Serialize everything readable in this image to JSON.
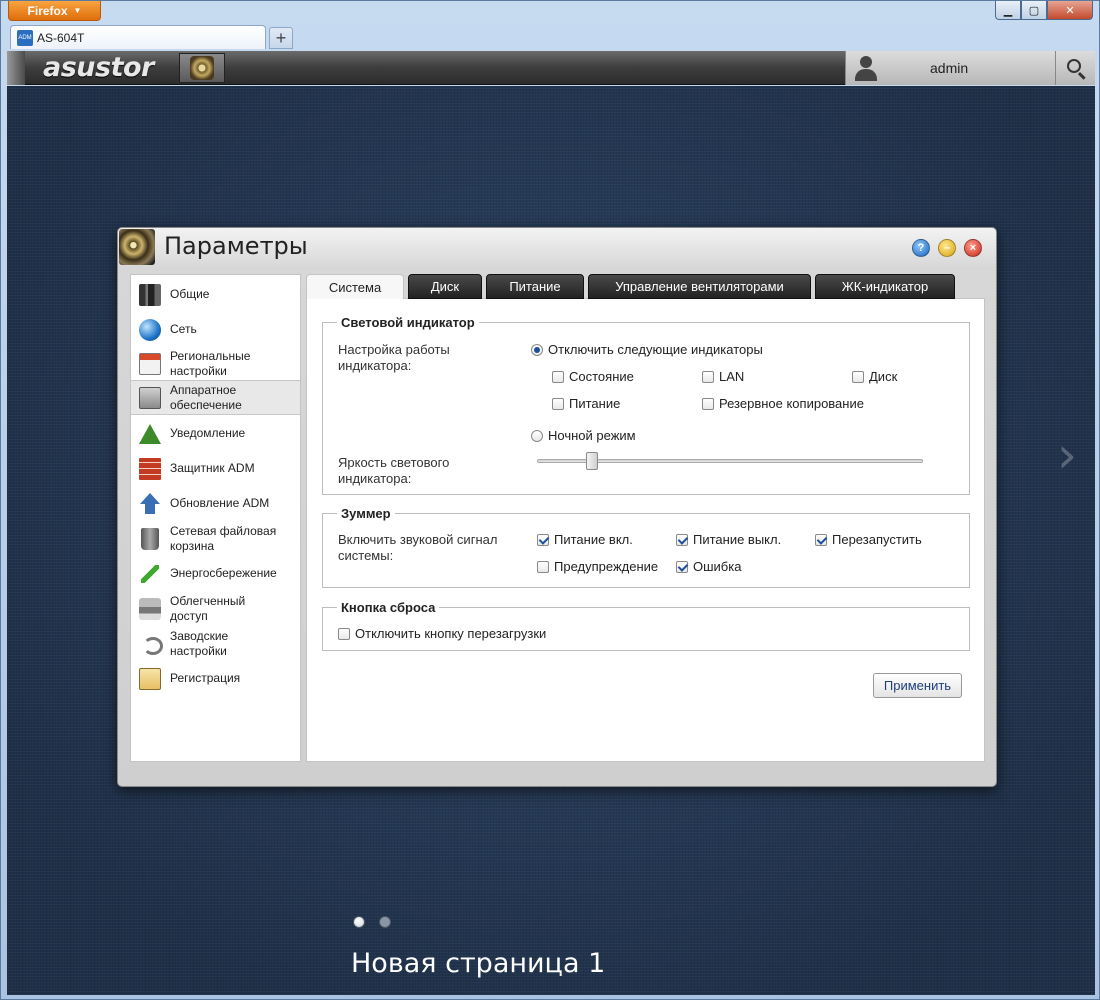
{
  "browser": {
    "app_button": "Firefox",
    "tab_title": "AS-604T",
    "tab_favicon": "ADM",
    "new_tab": "+",
    "controls": {
      "minimize": "▁",
      "maximize": "▢",
      "close": "✕"
    }
  },
  "adm": {
    "logo": "asustor",
    "user": "admin"
  },
  "settings": {
    "title": "Параметры",
    "buttons": {
      "help": "?",
      "minimize": "–",
      "close": "×"
    },
    "nav": [
      {
        "label": "Общие",
        "icon": "server-icon"
      },
      {
        "label": "Сеть",
        "icon": "globe-icon"
      },
      {
        "label": "Региональные настройки",
        "icon": "calendar-clock-icon"
      },
      {
        "label": "Аппаратное обеспечение",
        "icon": "hard-drive-icon"
      },
      {
        "label": "Уведомление",
        "icon": "warning-icon"
      },
      {
        "label": "Защитник ADM",
        "icon": "firewall-icon"
      },
      {
        "label": "Обновление ADM",
        "icon": "upload-arrow-icon"
      },
      {
        "label": "Сетевая файловая корзина",
        "icon": "trash-icon"
      },
      {
        "label": "Энергосбережение",
        "icon": "lightning-icon"
      },
      {
        "label": "Облегченный доступ",
        "icon": "printer-icon"
      },
      {
        "label": "Заводские настройки",
        "icon": "undo-icon"
      },
      {
        "label": "Регистрация",
        "icon": "clipboard-icon"
      }
    ],
    "tabs": [
      "Система",
      "Диск",
      "Питание",
      "Управление вентиляторами",
      "ЖК-индикатор"
    ],
    "led": {
      "legend": "Световой индикатор",
      "setting_label": "Настройка работы индикатора:",
      "disable_option": "Отключить следующие индикаторы",
      "checkboxes": {
        "status": "Состояние",
        "lan": "LAN",
        "disk": "Диск",
        "power": "Питание",
        "backup": "Резервное копирование"
      },
      "night_mode": "Ночной режим",
      "brightness_label": "Яркость светового индикатора:",
      "brightness_level": 0.13
    },
    "buzzer": {
      "legend": "Зуммер",
      "label": "Включить звуковой сигнал системы:",
      "checkboxes": {
        "power_on": "Питание вкл.",
        "power_off": "Питание выкл.",
        "restart": "Перезапустить",
        "warning": "Предупреждение",
        "error": "Ошибка"
      }
    },
    "reset": {
      "legend": "Кнопка сброса",
      "disable": "Отключить кнопку перезагрузки"
    },
    "apply": "Применить"
  },
  "desktop": {
    "next_arrow": "›",
    "page_name": "Новая страница 1"
  }
}
